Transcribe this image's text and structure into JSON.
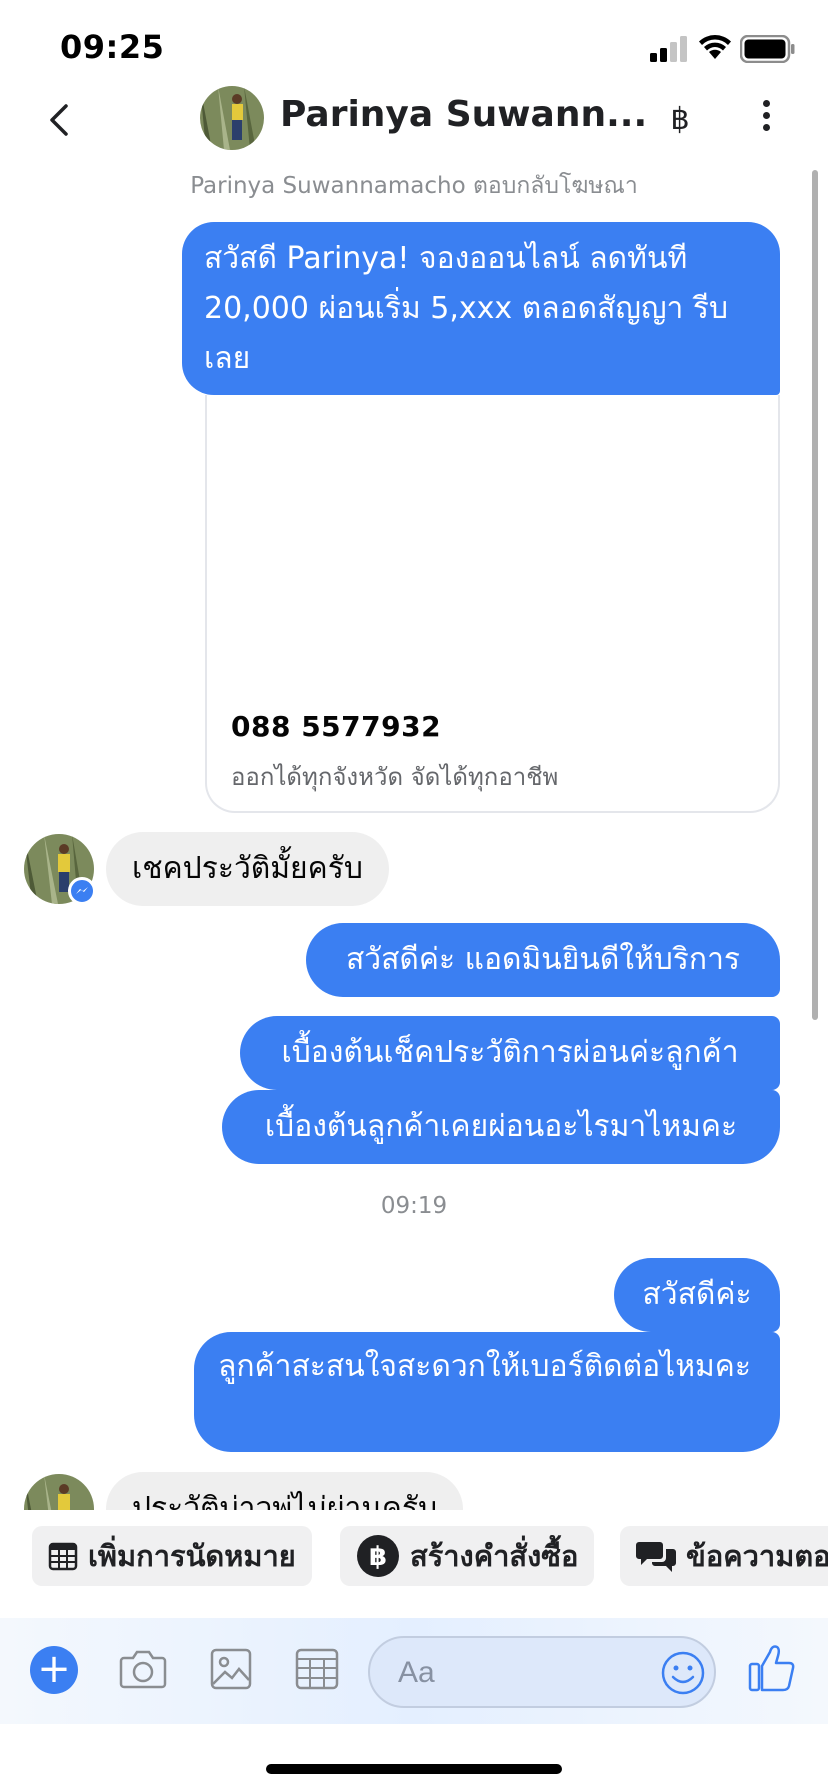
{
  "status_bar": {
    "time": "09:25"
  },
  "header": {
    "contact_name": "Parinya Suwann...",
    "baht_symbol": "฿",
    "context_line": "Parinya Suwannamacho ตอบกลับโฆษณา"
  },
  "messages": [
    {
      "direction": "out",
      "text": "สวัสดี Parinya! จองออนไลน์ ลดทันที 20,000 ผ่อนเริ่ม 5,xxx ตลอดสัญญา รีบเลย"
    },
    {
      "direction": "in",
      "text": "เชคประวัติมั้ยครับ"
    },
    {
      "direction": "out",
      "text": "สวัสดีค่ะ แอดมินยินดีให้บริการ"
    },
    {
      "direction": "out",
      "text": "เบื้องต้นเช็คประวัติการผ่อนค่ะลูกค้า"
    },
    {
      "direction": "out",
      "text": "เบื้องต้นลูกค้าเคยผ่อนอะไรมาไหมคะ"
    },
    {
      "direction": "out",
      "text": "สวัสดีค่ะ"
    },
    {
      "direction": "out",
      "text": "ลูกค้าสะสนใจสะดวกให้เบอร์ติดต่อไหมคะ"
    },
    {
      "direction": "in",
      "text": "ประวัติบ่าวพ่ไม่ผ่านครับ"
    }
  ],
  "ad_card": {
    "phone": "088 5577932",
    "description": "ออกได้ทุกจังหวัด จัดได้ทุกอาชีพ"
  },
  "timestamp": "09:19",
  "quick_actions": [
    {
      "label": "เพิ่มการนัดหมาย",
      "icon": "calendar-icon"
    },
    {
      "label": "สร้างคำสั่งซื้อ",
      "icon": "baht-icon"
    },
    {
      "label": "ข้อความตอ",
      "icon": "chat-bubbles-icon"
    }
  ],
  "composer": {
    "placeholder": "Aa",
    "plus": "+"
  },
  "colors": {
    "accent": "#3b7ff2",
    "incoming_bubble": "#efefef",
    "secondary_text": "#8a8d91"
  }
}
